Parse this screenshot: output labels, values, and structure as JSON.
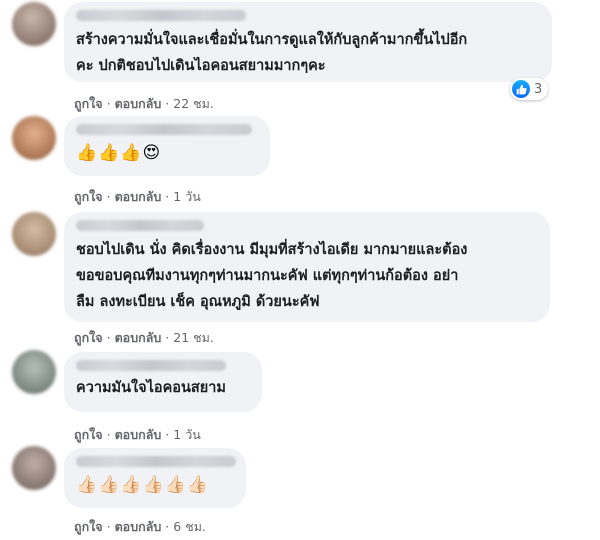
{
  "comments": [
    {
      "text": "สร้างความมั่นใจและเชื่อมั่นในการดูแลให้กับลูกค้ามากขึ้นไปอีก\nคะ ปกติชอบไปเดินไอคอนสยามมากๆคะ",
      "like": "ถูกใจ",
      "reply": "ตอบกลับ",
      "time": "22 ชม.",
      "reaction_count": "3",
      "reaction_icon": "thumbs-up-icon",
      "avatar_color": "#9c8a80"
    },
    {
      "text": "👍👍👍😍",
      "like": "ถูกใจ",
      "reply": "ตอบกลับ",
      "time": "1 วัน",
      "avatar_color": "#b07a58"
    },
    {
      "text": "ชอบไปเดิน นั่ง คิดเรื่องงาน มีมุมที่สร้างไอเดีย มากมายและต้อง\nขอขอบคุณทีมงานทุกๆท่านมากนะคัฟ แต่ทุกๆท่านก้อต้อง อย่า\nลืม ลงทะเบียน เช็ค อุณหภูมิ ด้วยนะคัฟ",
      "like": "ถูกใจ",
      "reply": "ตอบกลับ",
      "time": "21 ชม.",
      "avatar_color": "#a88d74"
    },
    {
      "text": "ความมันใจไอคอนสยาม",
      "like": "ถูกใจ",
      "reply": "ตอบกลับ",
      "time": "1 วัน",
      "avatar_color": "#7f8a84"
    },
    {
      "text": "👍🏻👍🏻👍🏻👍🏻👍🏻👍🏻",
      "like": "ถูกใจ",
      "reply": "ตอบกลับ",
      "time": "6 ชม.",
      "avatar_color": "#8a7a74"
    }
  ],
  "separator": "·",
  "colors": {
    "bubble": "#f0f2f5",
    "meta_text": "#65676b",
    "like_blue": "#0866ff"
  }
}
